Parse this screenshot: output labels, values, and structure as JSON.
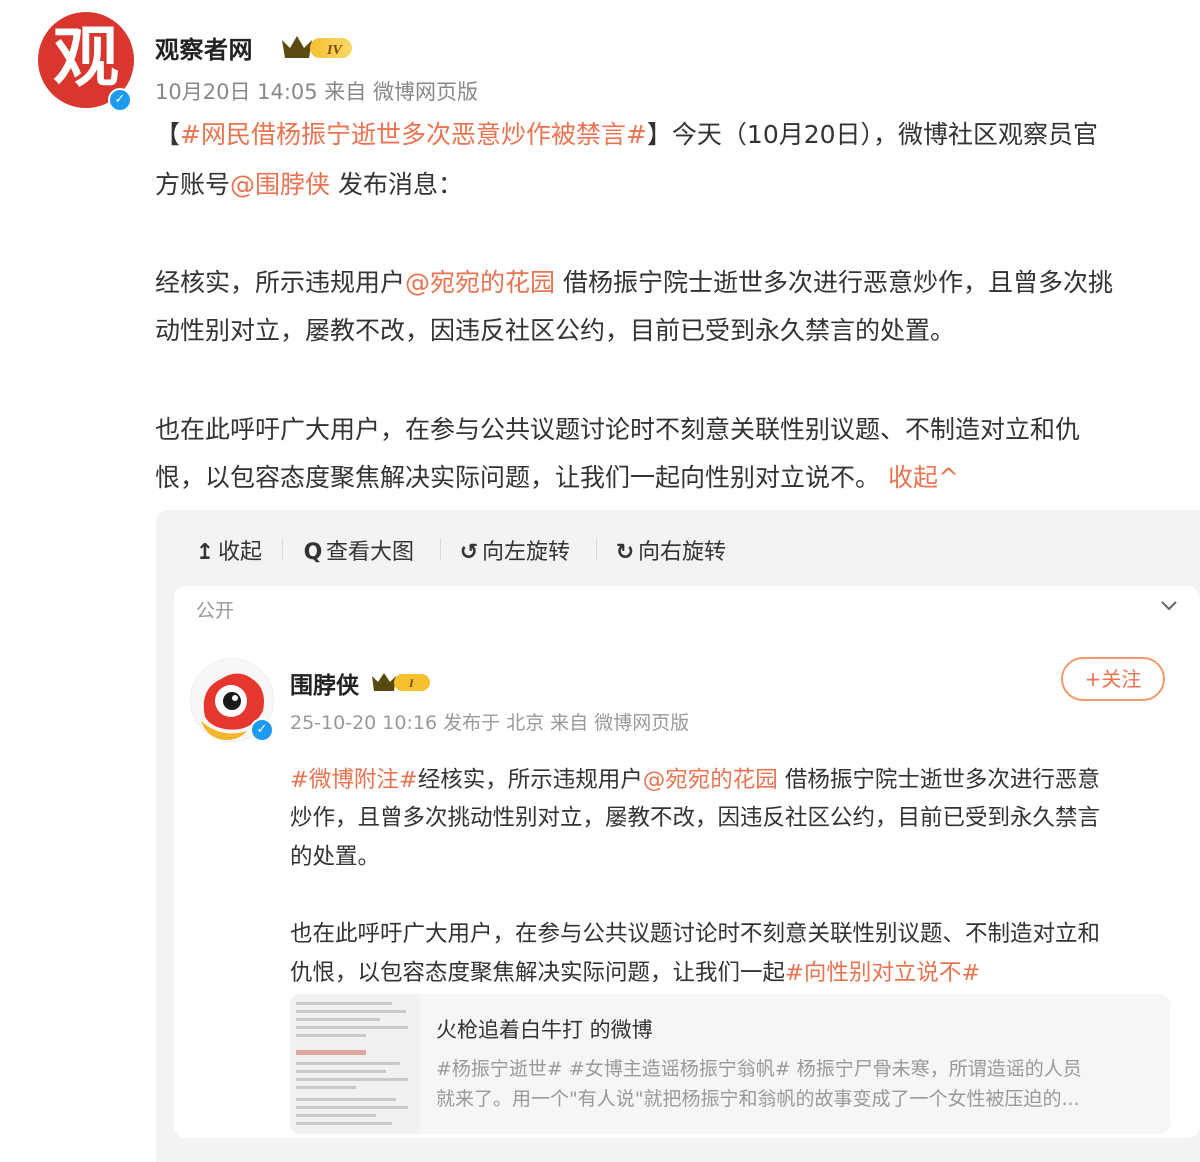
{
  "post": {
    "author": "观察者网",
    "avatar_char": "观",
    "level_badge": "IV",
    "meta": "10月20日 14:05  来自 微博网页版",
    "intro_pre": "【",
    "intro_topic": "#网民借杨振宁逝世多次恶意炒作被禁言#",
    "intro_post": "】今天（10月20日），微博社区观察员官",
    "line2_pre": "方账号",
    "line2_mention": "@围脖侠",
    "line2_post": " 发布消息：",
    "p2_l1_pre": "经核实，所示违规用户",
    "p2_l1_mention": "@宛宛的花园",
    "p2_l1_post": " 借杨振宁院士逝世多次进行恶意炒作，且曾多次挑",
    "p2_l2": "动性别对立，屡教不改，因违反社区公约，目前已受到永久禁言的处置。",
    "p3_l1": "也在此呼吁广大用户，在参与公共议题讨论时不刻意关联性别议题、不制造对立和仇",
    "p3_l2": "恨，以包容态度聚焦解决实际问题，让我们一起向性别对立说不。",
    "collapse": "收起",
    "collapse_arrow": "^"
  },
  "toolbar": {
    "items": [
      {
        "icon": "↥",
        "label": "收起"
      },
      {
        "icon": "Q",
        "label": "查看大图"
      },
      {
        "icon": "↺",
        "label": "向左旋转"
      },
      {
        "icon": "↻",
        "label": "向右旋转"
      }
    ]
  },
  "card": {
    "visibility": "公开",
    "username": "围脖侠",
    "level_badge": "I",
    "follow": "+关注",
    "meta": "25-10-20 10:16 发布于 北京  来自 微博网页版",
    "l1_topic": "#微博附注#",
    "l1_text": "经核实，所示违规用户",
    "l1_mention": "@宛宛的花园",
    "l1_post": " 借杨振宁院士逝世多次进行恶意",
    "l2": "炒作，且曾多次挑动性别对立，屡教不改，因违反社区公约，目前已受到永久禁言",
    "l3": "的处置。",
    "l4": "也在此呼吁广大用户，在参与公共议题讨论时不刻意关联性别议题、不制造对立和",
    "l5_pre": "仇恨，以包容态度聚焦解决实际问题，让我们一起",
    "l5_topic": "#向性别对立说不#",
    "quote": {
      "title": "火枪追着白牛打 的微博",
      "line1": "#杨振宁逝世# #女博主造谣杨振宁翁帆# 杨振宁尸骨未寒，所谓造谣的人员",
      "line2": "就来了。用一个\"有人说\"就把杨振宁和翁帆的故事变成了一个女性被压迫的..."
    }
  },
  "colors": {
    "accent": "#eb7350",
    "verify": "#1d9bf0",
    "brand_red": "#d9362e",
    "panel_bg": "#f3f3f4"
  }
}
